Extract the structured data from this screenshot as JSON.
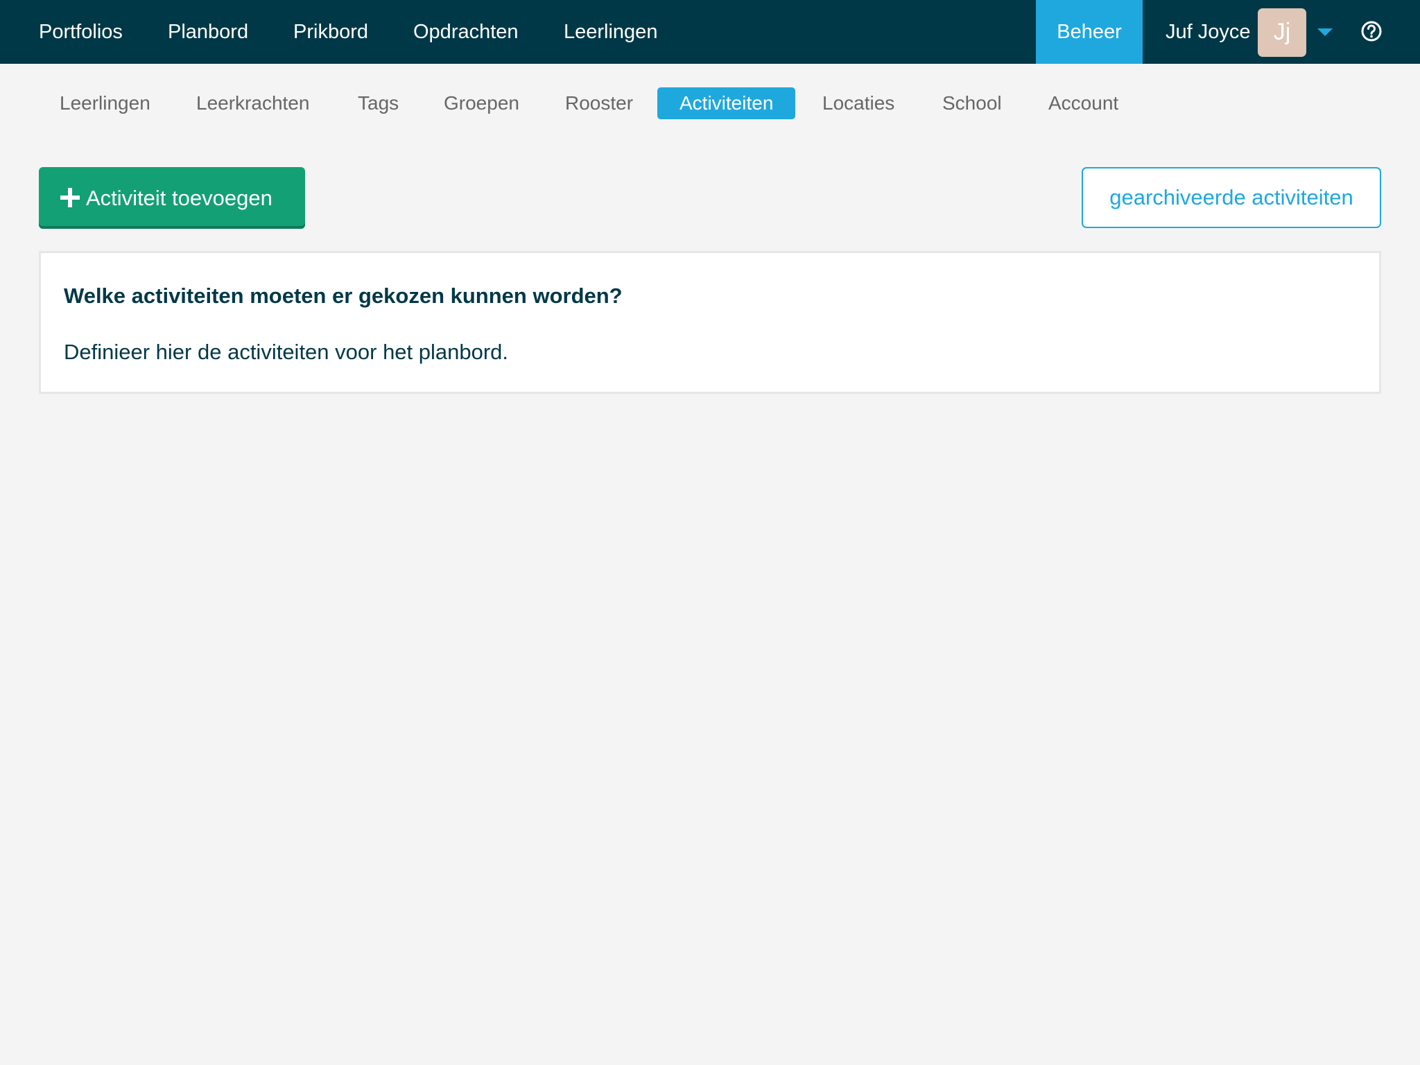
{
  "topnav": {
    "items": [
      "Portfolios",
      "Planbord",
      "Prikbord",
      "Opdrachten",
      "Leerlingen"
    ],
    "beheer": "Beheer",
    "user_name": "Juf Joyce",
    "avatar_initials": "Jj",
    "help_icon": "question-circle-icon"
  },
  "subnav": {
    "items": [
      "Leerlingen",
      "Leerkrachten",
      "Tags",
      "Groepen",
      "Rooster",
      "Activiteiten",
      "Locaties",
      "School",
      "Account"
    ],
    "active": "Activiteiten"
  },
  "actions": {
    "add_label": "Activiteit toevoegen",
    "archived_label": "gearchiveerde activiteiten"
  },
  "panel": {
    "heading": "Welke activiteiten moeten er gekozen kunnen worden?",
    "text": "Definieer hier de activiteiten voor het planbord."
  },
  "colors": {
    "topbar": "#013847",
    "accent": "#1fa8de",
    "add_button": "#13a075",
    "background": "#f4f4f4"
  }
}
